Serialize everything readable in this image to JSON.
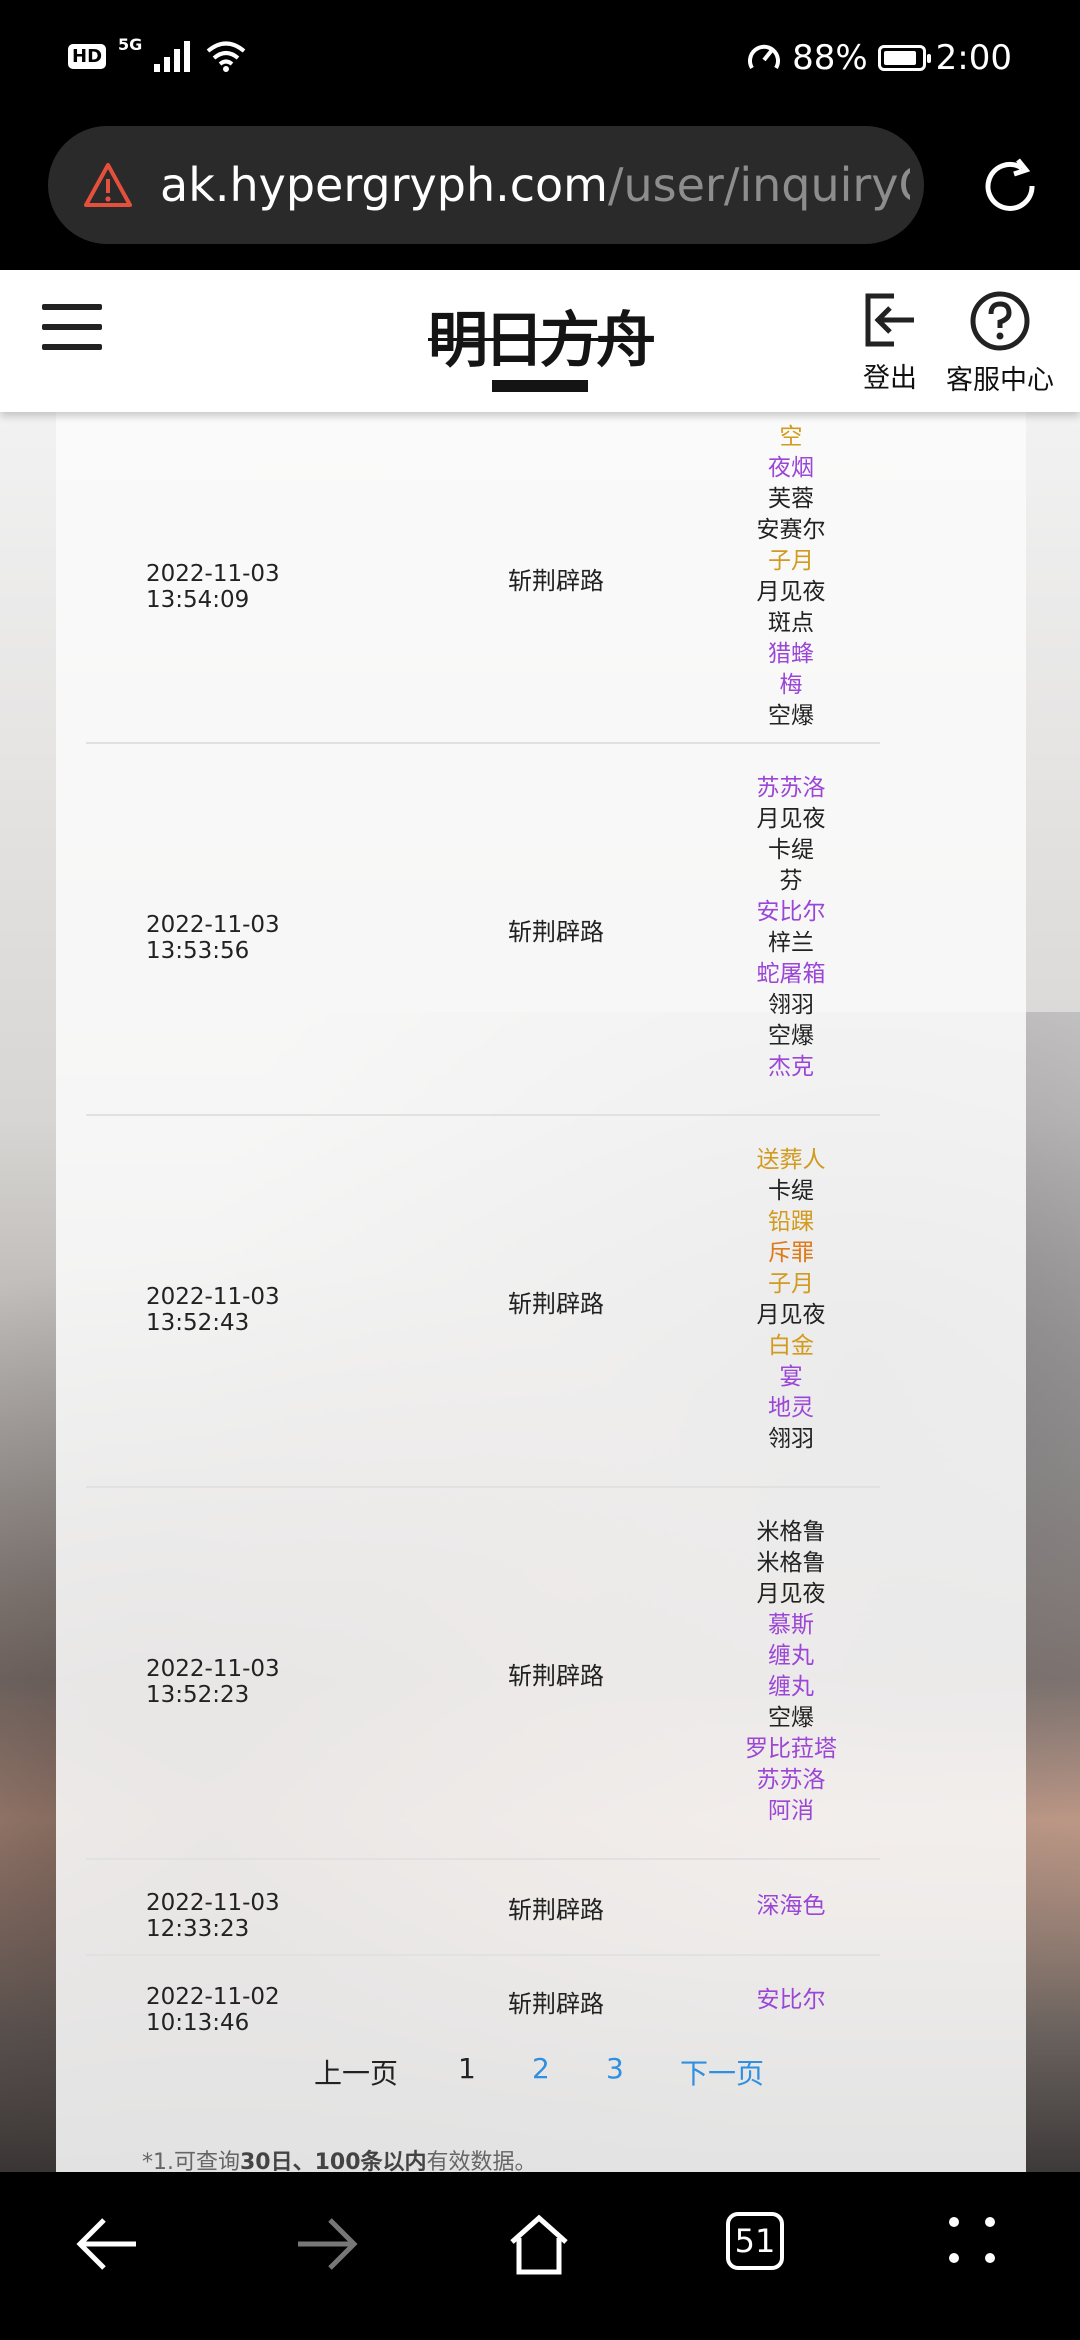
{
  "status_bar": {
    "hd": "HD",
    "network": "5G",
    "battery": "88%",
    "battery_level": 0.88,
    "time": "2:00"
  },
  "browser": {
    "url_domain": "ak.hypergryph.com",
    "url_path": "/user/inquiryGa",
    "tab_count": "51"
  },
  "header": {
    "logo_text": "明日方舟",
    "logout_label": "登出",
    "help_label": "客服中心"
  },
  "colors": {
    "rarity3": "#222222",
    "rarity4": "#9b46d6",
    "rarity5": "#d29a1e",
    "rarity6": "#e07a1a"
  },
  "records": [
    {
      "time": "2022-11-03 13:54:09",
      "pool": "斩荆辟路",
      "chars": [
        {
          "name": "空",
          "rarity": 5
        },
        {
          "name": "夜烟",
          "rarity": 4
        },
        {
          "name": "芙蓉",
          "rarity": 3
        },
        {
          "name": "安赛尔",
          "rarity": 3
        },
        {
          "name": "子月",
          "rarity": 5
        },
        {
          "name": "月见夜",
          "rarity": 3
        },
        {
          "name": "斑点",
          "rarity": 3
        },
        {
          "name": "猎蜂",
          "rarity": 4
        },
        {
          "name": "梅",
          "rarity": 4
        },
        {
          "name": "空爆",
          "rarity": 3
        }
      ]
    },
    {
      "time": "2022-11-03 13:53:56",
      "pool": "斩荆辟路",
      "chars": [
        {
          "name": "苏苏洛",
          "rarity": 4
        },
        {
          "name": "月见夜",
          "rarity": 3
        },
        {
          "name": "卡缇",
          "rarity": 3
        },
        {
          "name": "芬",
          "rarity": 3
        },
        {
          "name": "安比尔",
          "rarity": 4
        },
        {
          "name": "梓兰",
          "rarity": 3
        },
        {
          "name": "蛇屠箱",
          "rarity": 4
        },
        {
          "name": "翎羽",
          "rarity": 3
        },
        {
          "name": "空爆",
          "rarity": 3
        },
        {
          "name": "杰克",
          "rarity": 4
        }
      ]
    },
    {
      "time": "2022-11-03 13:52:43",
      "pool": "斩荆辟路",
      "chars": [
        {
          "name": "送葬人",
          "rarity": 5
        },
        {
          "name": "卡缇",
          "rarity": 3
        },
        {
          "name": "铅踝",
          "rarity": 5
        },
        {
          "name": "斥罪",
          "rarity": 6
        },
        {
          "name": "子月",
          "rarity": 5
        },
        {
          "name": "月见夜",
          "rarity": 3
        },
        {
          "name": "白金",
          "rarity": 5
        },
        {
          "name": "宴",
          "rarity": 4
        },
        {
          "name": "地灵",
          "rarity": 4
        },
        {
          "name": "翎羽",
          "rarity": 3
        }
      ]
    },
    {
      "time": "2022-11-03 13:52:23",
      "pool": "斩荆辟路",
      "chars": [
        {
          "name": "米格鲁",
          "rarity": 3
        },
        {
          "name": "米格鲁",
          "rarity": 3
        },
        {
          "name": "月见夜",
          "rarity": 3
        },
        {
          "name": "慕斯",
          "rarity": 4
        },
        {
          "name": "缠丸",
          "rarity": 4
        },
        {
          "name": "缠丸",
          "rarity": 4
        },
        {
          "name": "空爆",
          "rarity": 3
        },
        {
          "name": "罗比菈塔",
          "rarity": 4
        },
        {
          "name": "苏苏洛",
          "rarity": 4
        },
        {
          "name": "阿消",
          "rarity": 4
        }
      ]
    },
    {
      "time": "2022-11-03 12:33:23",
      "pool": "斩荆辟路",
      "chars": [
        {
          "name": "深海色",
          "rarity": 4
        }
      ]
    },
    {
      "time": "2022-11-02 10:13:46",
      "pool": "斩荆辟路",
      "chars": [
        {
          "name": "安比尔",
          "rarity": 4
        }
      ]
    }
  ],
  "pager": {
    "prev": "上一页",
    "current": "1",
    "page2": "2",
    "page3": "3",
    "next": "下一页"
  },
  "footnote": {
    "prefix": "*1.可查询",
    "bold1": "30日、100条以内",
    "suffix": "有效数据。"
  }
}
